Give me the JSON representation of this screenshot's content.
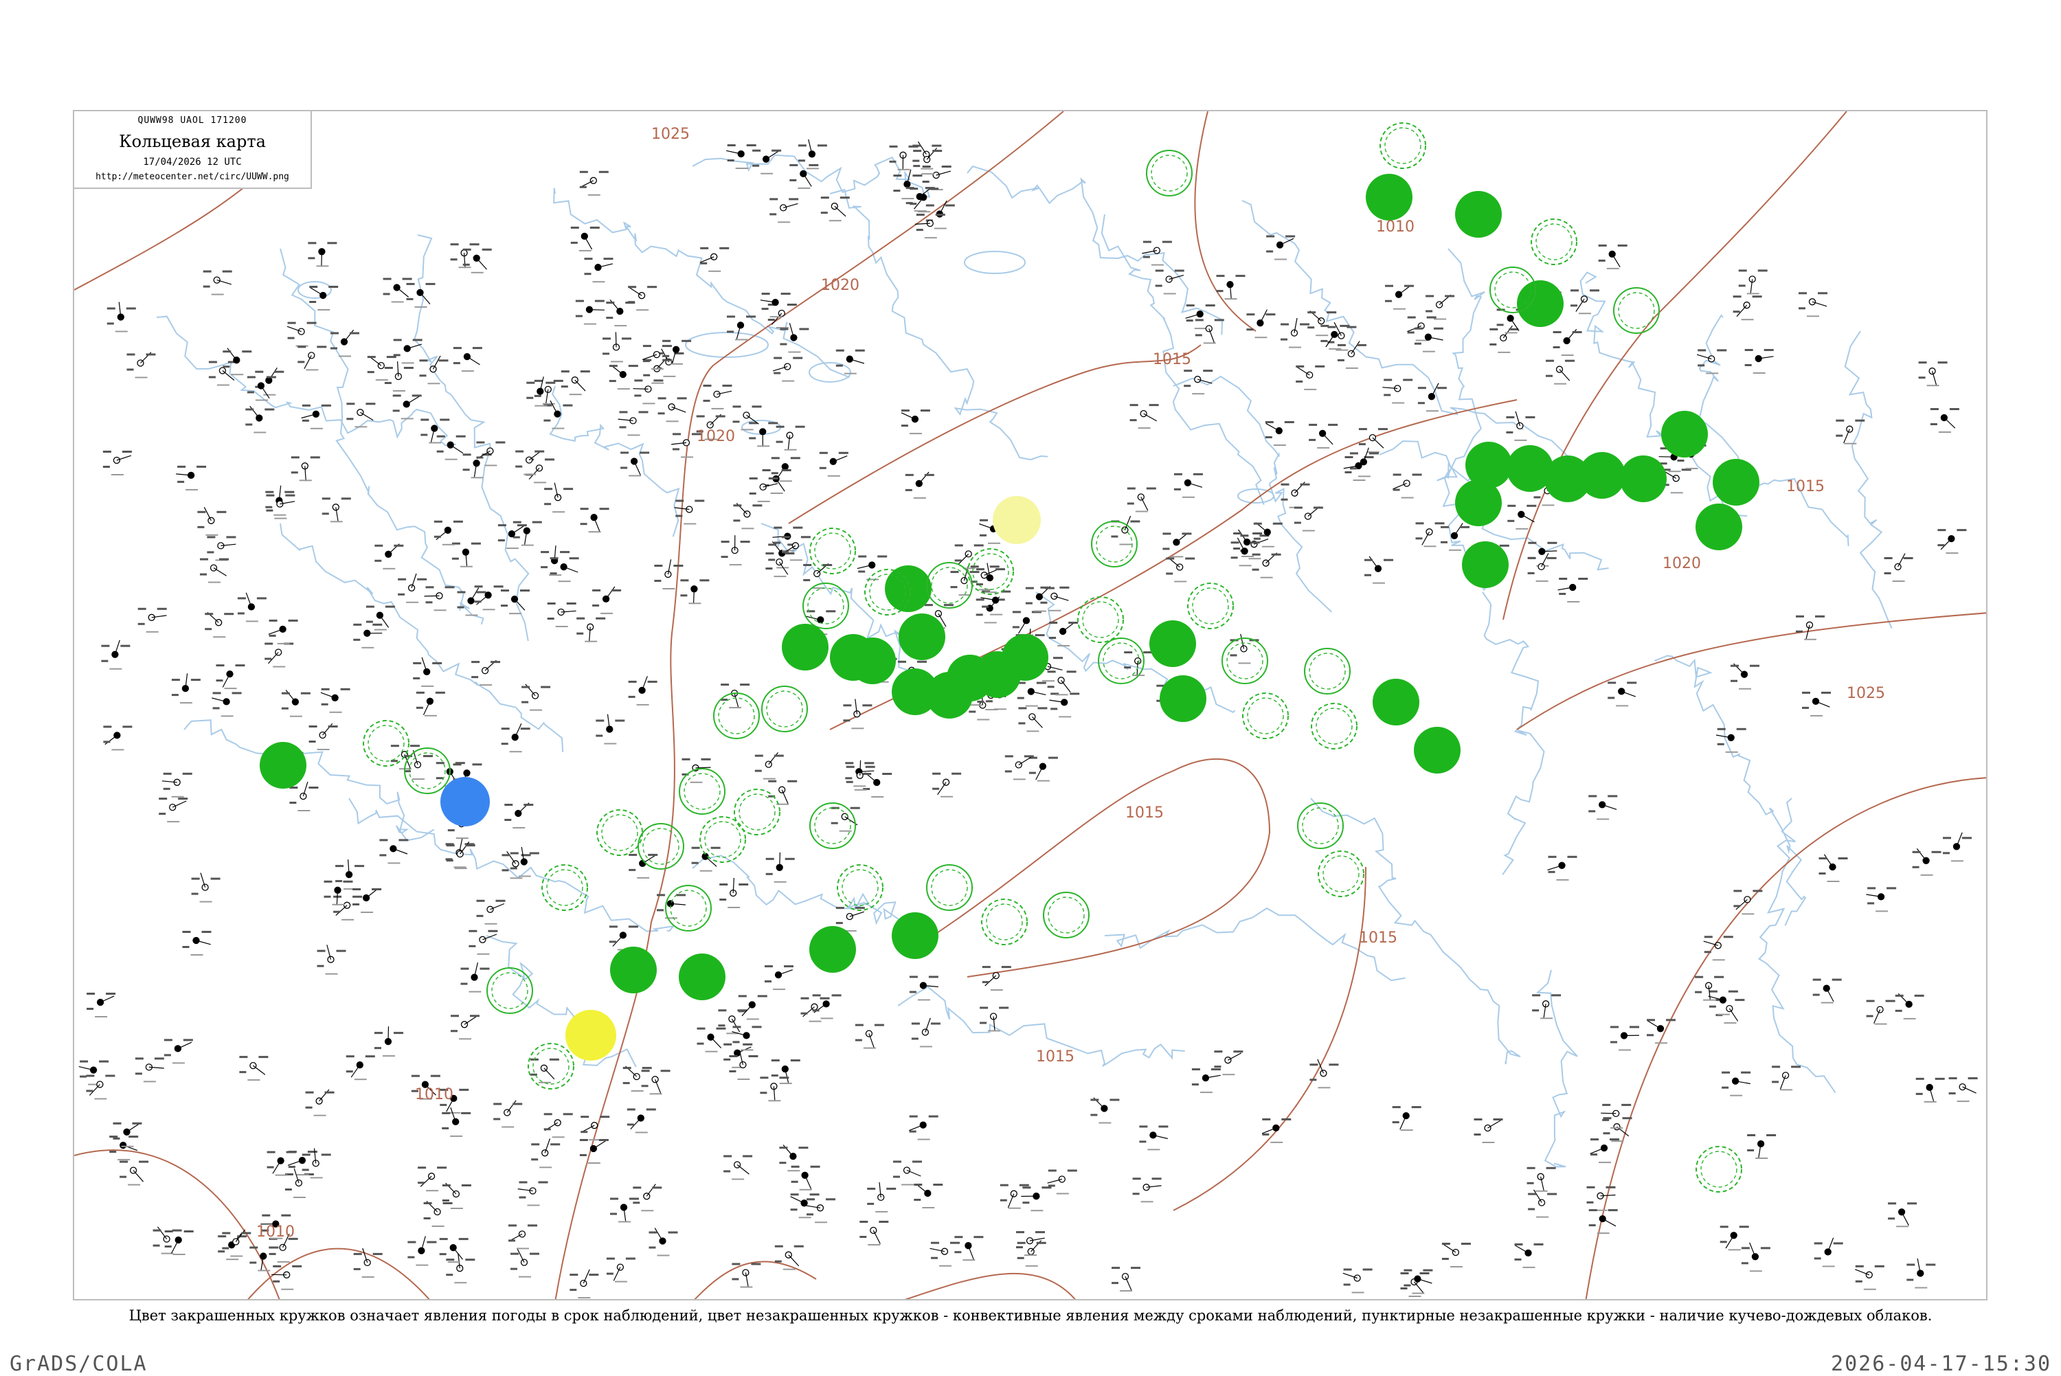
{
  "header": {
    "code": "QUWW98 UAOL 171200",
    "title": "Кольцевая карта",
    "date": "17/04/2026 12 UTC",
    "url": "http://meteocenter.net/circ/UUWW.png"
  },
  "caption": "Цвет закрашенных кружков означает явления погоды в срок наблюдений, цвет незакрашенных кружков - конвективные явления между сроками наблюдений, пунктирные незакрашенные кружки - наличие кучево-дождевых облаков.",
  "footer": {
    "left": "GrADS/COLA",
    "right": "2026-04-17-15:30"
  },
  "colors": {
    "isobar": "#b5684f",
    "river": "#a9cbe8",
    "shower": "#1db51d",
    "ring": "#2bb52b",
    "snow": "#3a86f0",
    "fog": "#f2f23a",
    "haze": "#f6f6a0",
    "station": "#000000"
  },
  "isobar_labels": [
    "1025",
    "1020",
    "1020",
    "1015",
    "1015",
    "1015",
    "1010",
    "1010",
    "1010",
    "1020",
    "1025",
    "1015",
    "1015"
  ],
  "legend_meaning": {
    "filled_circle": "явления погоды в срок наблюдений",
    "open_circle": "конвективные явления между сроками наблюдений",
    "dashed_circle": "наличие кучево-дождевых облаков"
  }
}
